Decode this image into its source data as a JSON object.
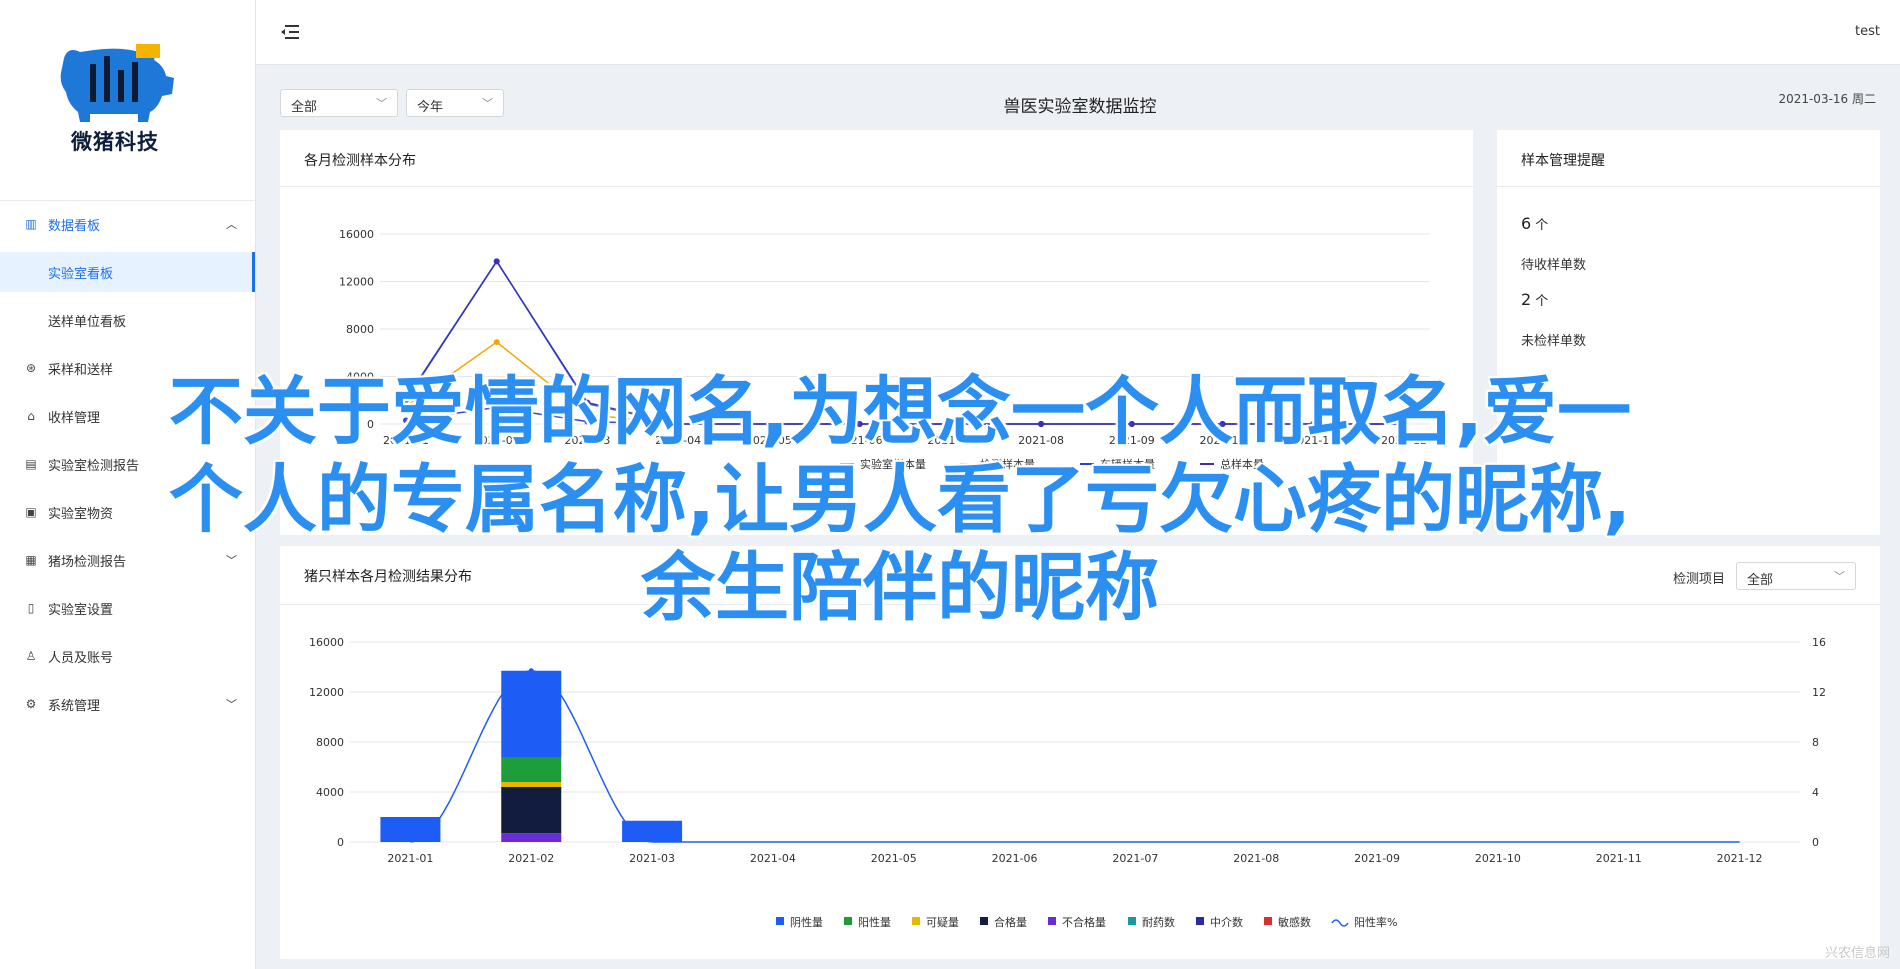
{
  "brand": {
    "name": "微猪科技"
  },
  "header": {
    "user": "test"
  },
  "sidebar": {
    "items": [
      {
        "label": "数据看板",
        "icon": "bar-chart-icon"
      },
      {
        "label": "实验室看板"
      },
      {
        "label": "送样单位看板"
      },
      {
        "label": "采样和送样",
        "icon": "sample-icon"
      },
      {
        "label": "收样管理",
        "icon": "inbox-icon"
      },
      {
        "label": "实验室检测报告",
        "icon": "report-icon"
      },
      {
        "label": "实验室物资",
        "icon": "supplies-icon"
      },
      {
        "label": "猪场检测报告",
        "icon": "farm-report-icon"
      },
      {
        "label": "实验室设置",
        "icon": "lab-settings-icon"
      },
      {
        "label": "人员及账号",
        "icon": "user-icon"
      },
      {
        "label": "系统管理",
        "icon": "gear-icon"
      }
    ]
  },
  "filters": {
    "range": "全部",
    "period": "今年"
  },
  "page": {
    "title": "兽医实验室数据监控",
    "date": "2021-03-16 周二"
  },
  "panel_monthly": {
    "title": "各月检测样本分布"
  },
  "panel_reminder": {
    "title": "样本管理提醒",
    "pending_count": "6",
    "pending_unit": "个",
    "pending_label": "待收样单数",
    "unchecked_count": "2",
    "unchecked_unit": "个",
    "unchecked_label": "未检样单数"
  },
  "panel_results": {
    "title": "猪只样本各月检测结果分布",
    "filter_label": "检测项目",
    "filter_value": "全部"
  },
  "overlay": {
    "line1": "不关于爱情的网名,为想念一个人而取名,爱一",
    "line2": "个人的专属名称,让男人看了亏欠心疼的昵称,",
    "line3": "余生陪伴的昵称"
  },
  "watermark": "兴农信息网",
  "chart_data": [
    {
      "type": "line",
      "title": "各月检测样本分布",
      "x": [
        "2021-01",
        "2021-02",
        "2021-03",
        "2021-04",
        "2021-05",
        "2021-06",
        "2021-07",
        "2021-08",
        "2021-09",
        "2021-10",
        "2021-11",
        "2021-12"
      ],
      "yticks": [
        0,
        4000,
        8000,
        12000,
        16000
      ],
      "ylim": [
        0,
        16000
      ],
      "legend_visible": [
        "实验室样本量",
        "检测样本量",
        "车辆样本量",
        "总样本量"
      ],
      "series": [
        {
          "name": "实验室样本量",
          "color": "#1e6fe8",
          "values": [
            2000,
            13700,
            1700,
            0,
            0,
            0,
            0,
            0,
            0,
            0,
            0,
            0
          ]
        },
        {
          "name": "检测样本量",
          "color": "#f0a800",
          "values": [
            1500,
            6900,
            800,
            0,
            0,
            0,
            0,
            0,
            0,
            0,
            0,
            0
          ]
        },
        {
          "name": "车辆样本量",
          "color": "#2a40d0",
          "values": [
            300,
            1400,
            200,
            0,
            0,
            0,
            0,
            0,
            0,
            0,
            0,
            0
          ]
        },
        {
          "name": "总样本量",
          "color": "#3a2fb8",
          "values": [
            2100,
            13700,
            1800,
            0,
            0,
            0,
            0,
            0,
            0,
            0,
            0,
            0
          ]
        }
      ],
      "grid": true,
      "legend": "bottom"
    },
    {
      "type": "bar",
      "title": "猪只样本各月检测结果分布",
      "categories": [
        "2021-01",
        "2021-02",
        "2021-03",
        "2021-04",
        "2021-05",
        "2021-06",
        "2021-07",
        "2021-08",
        "2021-09",
        "2021-10",
        "2021-11",
        "2021-12"
      ],
      "ylim": [
        0,
        16000
      ],
      "yticks": [
        0,
        4000,
        8000,
        12000,
        16000
      ],
      "y2ticks": [
        0,
        4,
        8,
        12,
        16
      ],
      "stack": [
        {
          "name": "阴性量",
          "color": "#1e5df5",
          "values": [
            2000,
            6900,
            1700,
            0,
            0,
            0,
            0,
            0,
            0,
            0,
            0,
            0
          ]
        },
        {
          "name": "阳性量",
          "color": "#1e9e3a",
          "values": [
            0,
            2000,
            0,
            0,
            0,
            0,
            0,
            0,
            0,
            0,
            0,
            0
          ]
        },
        {
          "name": "可疑量",
          "color": "#e8b800",
          "values": [
            0,
            400,
            0,
            0,
            0,
            0,
            0,
            0,
            0,
            0,
            0,
            0
          ]
        },
        {
          "name": "合格量",
          "color": "#121c3e",
          "values": [
            0,
            3700,
            0,
            0,
            0,
            0,
            0,
            0,
            0,
            0,
            0,
            0
          ]
        },
        {
          "name": "不合格量",
          "color": "#6a2bd8",
          "values": [
            0,
            700,
            0,
            0,
            0,
            0,
            0,
            0,
            0,
            0,
            0,
            0
          ]
        },
        {
          "name": "耐药数",
          "color": "#1a9a9a",
          "values": [
            0,
            0,
            0,
            0,
            0,
            0,
            0,
            0,
            0,
            0,
            0,
            0
          ]
        },
        {
          "name": "中介数",
          "color": "#2a2aa8",
          "values": [
            0,
            0,
            0,
            0,
            0,
            0,
            0,
            0,
            0,
            0,
            0,
            0
          ]
        },
        {
          "name": "敏感数",
          "color": "#d83030",
          "values": [
            0,
            0,
            0,
            0,
            0,
            0,
            0,
            0,
            0,
            0,
            0,
            0
          ]
        }
      ],
      "line": {
        "name": "阳性率%",
        "color": "#1e5df5",
        "values": [
          0,
          13.7,
          0,
          0,
          0,
          0,
          0,
          0,
          0,
          0,
          0,
          0
        ]
      },
      "grid": true,
      "legend": "bottom"
    }
  ]
}
